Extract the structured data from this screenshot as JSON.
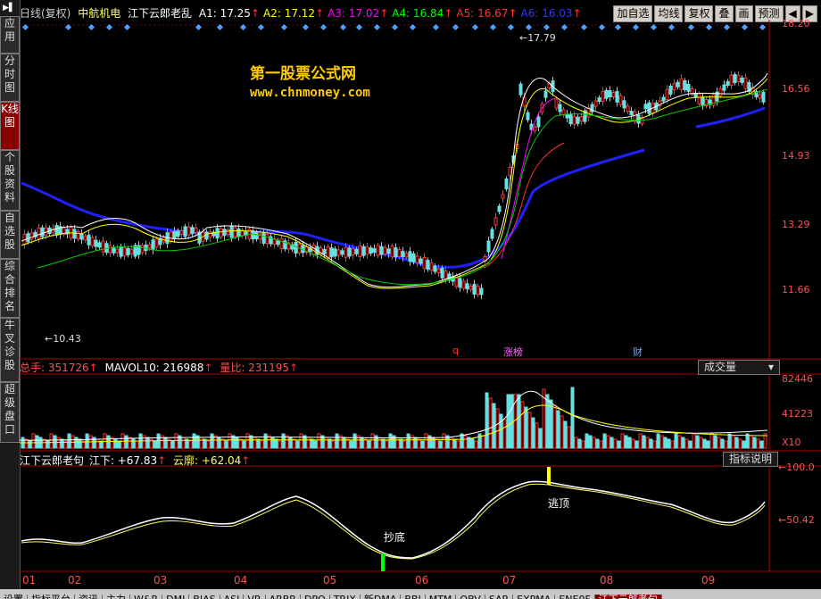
{
  "sidebar": {
    "top_label": "▶▌",
    "items": [
      {
        "label": "应用",
        "active": false
      },
      {
        "label": "分时图",
        "active": false
      },
      {
        "label": "K线图",
        "active": true
      },
      {
        "label": "个股资料",
        "active": false
      },
      {
        "label": "自选股",
        "active": false
      },
      {
        "label": "综合排名",
        "active": false
      },
      {
        "label": "牛叉诊股",
        "active": false
      },
      {
        "label": "超级盘口",
        "active": false
      }
    ]
  },
  "header": {
    "period": "日线(复权)",
    "stock": "中航机电",
    "indicator": "江下云郎老乱",
    "ma": [
      {
        "label": "A1: 17.25",
        "color": "#ffffff"
      },
      {
        "label": "A2: 17.12",
        "color": "#ffff00"
      },
      {
        "label": "A3: 17.02",
        "color": "#ff00ff"
      },
      {
        "label": "A4: 16.84",
        "color": "#00ff00"
      },
      {
        "label": "A5: 16.67",
        "color": "#ff3333"
      },
      {
        "label": "A6: 16.03",
        "color": "#3333ff"
      }
    ],
    "buttons": [
      "加自选",
      "均线",
      "复权",
      "叠",
      "画",
      "预测",
      "◀",
      "▶"
    ]
  },
  "price_axis": [
    "18.20",
    "16.56",
    "14.93",
    "13.29",
    "11.66"
  ],
  "annotations": {
    "high": "17.79",
    "low": "10.43",
    "q": "q",
    "zhangbang": "涨榜",
    "cai": "财"
  },
  "watermark": {
    "line1": "第一股票公式网",
    "line2": "www.chnmoney.com"
  },
  "volume": {
    "zongshou": "总手: 351726",
    "mavol": "MAVOL10: 216988",
    "liangbi": "量比: 231195",
    "selector": "成交量",
    "axis": [
      "82446",
      "41223",
      "X10"
    ]
  },
  "indicator_panel": {
    "name": "江下云郎老句",
    "jiangxia": "江下: +67.83",
    "yunlang": "云廓: +62.04",
    "button": "指标说明",
    "axis": [
      "100.0",
      "50.42"
    ],
    "chaodi": "抄底",
    "taoding": "逃顶"
  },
  "months": [
    "01",
    "02",
    "03",
    "04",
    "05",
    "06",
    "07",
    "08",
    "09"
  ],
  "tabs": [
    {
      "label": "设置",
      "active": false
    },
    {
      "label": "指标平台",
      "active": false
    },
    {
      "label": "资讯",
      "active": false
    },
    {
      "label": "主力",
      "active": false
    },
    {
      "label": "W&R",
      "active": false
    },
    {
      "label": "DMI",
      "active": false
    },
    {
      "label": "BIAS",
      "active": false
    },
    {
      "label": "ASI",
      "active": false
    },
    {
      "label": "VR",
      "active": false
    },
    {
      "label": "ARBR",
      "active": false
    },
    {
      "label": "DPO",
      "active": false
    },
    {
      "label": "TRIX",
      "active": false
    },
    {
      "label": "新DMA",
      "active": false
    },
    {
      "label": "BBI",
      "active": false
    },
    {
      "label": "MTM",
      "active": false
    },
    {
      "label": "OBV",
      "active": false
    },
    {
      "label": "SAR",
      "active": false
    },
    {
      "label": "EXPMA",
      "active": false
    },
    {
      "label": "ENE0F",
      "active": false
    },
    {
      "label": "江下云郎老句",
      "active": true
    }
  ]
}
